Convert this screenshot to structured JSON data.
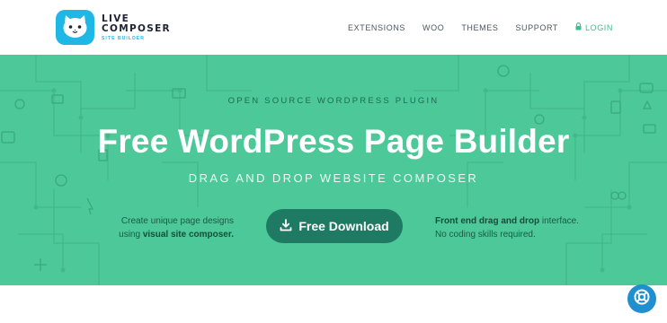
{
  "brand": {
    "line1": "LIVE",
    "line2": "COMPOSER",
    "line3": "SITE BUILDER",
    "badge_color": "#1fb7e6"
  },
  "nav": {
    "items": [
      "EXTENSIONS",
      "WOO",
      "THEMES",
      "SUPPORT"
    ],
    "login_label": "LOGIN"
  },
  "hero": {
    "kicker": "OPEN SOURCE WORDPRESS PLUGIN",
    "title": "Free WordPress Page Builder",
    "subtitle": "DRAG AND DROP WEBSITE COMPOSER",
    "left_note": {
      "line1": "Create unique page designs",
      "line2_prefix": "using ",
      "line2_strong": "visual site composer."
    },
    "right_note": {
      "line1_strong": "Front end drag and drop",
      "line1_rest": " interface.",
      "line2": "No coding skills required."
    },
    "download_label": "Free Download",
    "background": "#4cc899",
    "button_color": "#1e7a62"
  },
  "icons": [
    "cat-logo-icon",
    "lock-icon",
    "download-icon",
    "lifebuoy-icon"
  ]
}
